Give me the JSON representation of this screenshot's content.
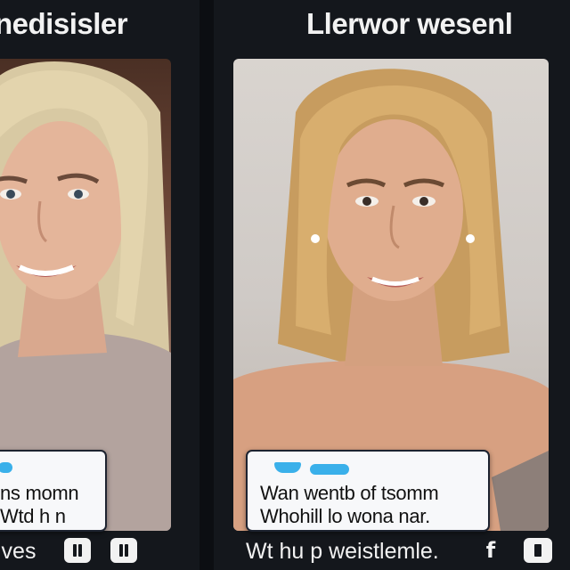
{
  "panels": {
    "left": {
      "title": "nedisisler",
      "caption_line1": "ns momn",
      "caption_line2": "h n",
      "caption_prefix": "Wtd",
      "bottom_text": "lves"
    },
    "right": {
      "title": "Llerwor wesenl",
      "caption_line1": "Wan wentb of tsomm",
      "caption_line2": "Whohill lo wona nar.",
      "bottom_text": "Wt hu p weistlemle."
    }
  },
  "controls": {
    "pause_1_icon": "pause-icon",
    "pause_2_icon": "pause-icon",
    "facebook_icon": "facebook-icon",
    "facebook_glyph": "f",
    "stop_icon": "stop-icon"
  },
  "colors": {
    "background": "#14171c",
    "title_text": "#f2f2f2",
    "accent_pill": "#3ab0ea",
    "card_bg": "#f7f8fa"
  }
}
